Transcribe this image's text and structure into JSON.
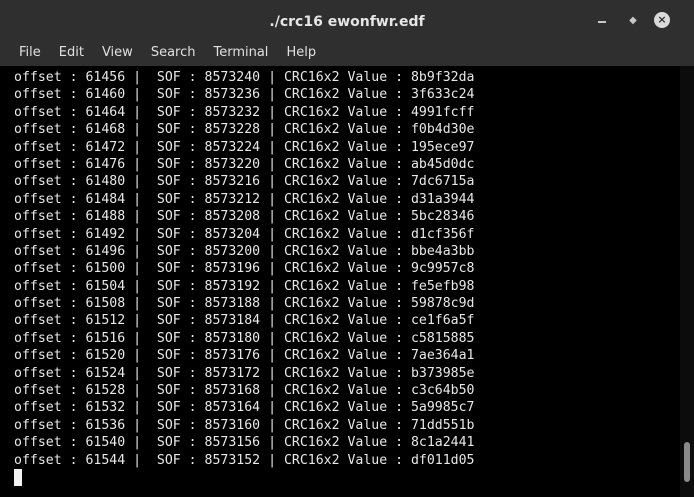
{
  "window": {
    "title": "./crc16 ewonfwr.edf",
    "controls": {
      "minimize_icon": "minimize-icon",
      "maximize_icon": "maximize-icon",
      "close_icon": "close-icon",
      "close_glyph": "×",
      "maximize_glyph": "◆"
    }
  },
  "menubar": {
    "items": [
      "File",
      "Edit",
      "View",
      "Search",
      "Terminal",
      "Help"
    ]
  },
  "terminal": {
    "lines": [
      "offset : 61456 |  SOF : 8573240 | CRC16x2 Value : 8b9f32da",
      "offset : 61460 |  SOF : 8573236 | CRC16x2 Value : 3f633c24",
      "offset : 61464 |  SOF : 8573232 | CRC16x2 Value : 4991fcff",
      "offset : 61468 |  SOF : 8573228 | CRC16x2 Value : f0b4d30e",
      "offset : 61472 |  SOF : 8573224 | CRC16x2 Value : 195ece97",
      "offset : 61476 |  SOF : 8573220 | CRC16x2 Value : ab45d0dc",
      "offset : 61480 |  SOF : 8573216 | CRC16x2 Value : 7dc6715a",
      "offset : 61484 |  SOF : 8573212 | CRC16x2 Value : d31a3944",
      "offset : 61488 |  SOF : 8573208 | CRC16x2 Value : 5bc28346",
      "offset : 61492 |  SOF : 8573204 | CRC16x2 Value : d1cf356f",
      "offset : 61496 |  SOF : 8573200 | CRC16x2 Value : bbe4a3bb",
      "offset : 61500 |  SOF : 8573196 | CRC16x2 Value : 9c9957c8",
      "offset : 61504 |  SOF : 8573192 | CRC16x2 Value : fe5efb98",
      "offset : 61508 |  SOF : 8573188 | CRC16x2 Value : 59878c9d",
      "offset : 61512 |  SOF : 8573184 | CRC16x2 Value : ce1f6a5f",
      "offset : 61516 |  SOF : 8573180 | CRC16x2 Value : c5815885",
      "offset : 61520 |  SOF : 8573176 | CRC16x2 Value : 7ae364a1",
      "offset : 61524 |  SOF : 8573172 | CRC16x2 Value : b373985e",
      "offset : 61528 |  SOF : 8573168 | CRC16x2 Value : c3c64b50",
      "offset : 61532 |  SOF : 8573164 | CRC16x2 Value : 5a9985c7",
      "offset : 61536 |  SOF : 8573160 | CRC16x2 Value : 71dd551b",
      "offset : 61540 |  SOF : 8573156 | CRC16x2 Value : 8c1a2441",
      "offset : 61544 |  SOF : 8573152 | CRC16x2 Value : df011d05"
    ]
  },
  "colors": {
    "terminal_bg": "#000000",
    "terminal_fg": "#e8e8e8",
    "chrome_bg": "#2f2f2f"
  }
}
